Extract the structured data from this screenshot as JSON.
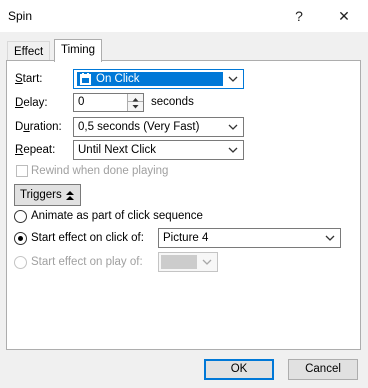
{
  "window": {
    "title": "Spin",
    "help_icon": "?",
    "close_icon": "✕"
  },
  "tabs": [
    {
      "label": "Effect"
    },
    {
      "label": "Timing"
    }
  ],
  "timing": {
    "start": {
      "label": "Start:",
      "value": "On Click",
      "icon": "clock-icon"
    },
    "delay": {
      "label": "Delay:",
      "value": "0",
      "unit": "seconds"
    },
    "duration": {
      "label": "Duration:",
      "value": "0,5 seconds (Very Fast)"
    },
    "repeat": {
      "label": "Repeat:",
      "value": "Until Next Click"
    },
    "rewind": {
      "label": "Rewind when done playing",
      "checked": false,
      "disabled": true
    },
    "triggers_button": {
      "label": "Triggers",
      "icon": "double-chevron-up-icon"
    },
    "radio_animate": {
      "label": "Animate as part of click sequence",
      "checked": false
    },
    "radio_click": {
      "label": "Start effect on click of:",
      "checked": true,
      "value": "Picture 4"
    },
    "radio_play": {
      "label": "Start effect on play of:",
      "checked": false,
      "disabled": true,
      "value": ""
    }
  },
  "buttons": {
    "ok": "OK",
    "cancel": "Cancel"
  },
  "colors": {
    "accent": "#0078d7",
    "selection": "#0078d7"
  }
}
